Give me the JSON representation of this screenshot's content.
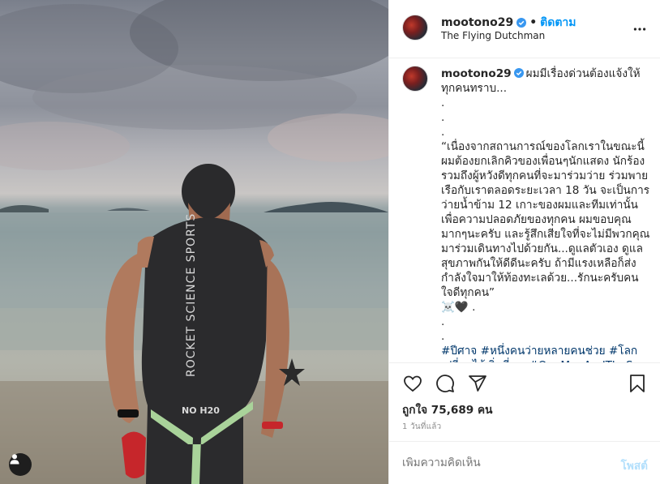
{
  "post": {
    "username": "mootono29",
    "follow_label": "ติดตาม",
    "separator": "•",
    "location": "The Flying Dutchman",
    "caption": {
      "username": "mootono29",
      "lines": [
        "ผมมีเรื่องด่วนต้องแจ้งให้ทุกคนทราบ...",
        ".",
        ".",
        ".",
        "“เนื่องจากสถานการณ์ของโลกเราในขณะนี้ ผมต้องยกเลิกคิวของเพื่อนๆนักแสดง นักร้อง รวมถึงผู้หวังดีทุกคนที่จะมาร่วมว่าย ร่วมพายเรือกับเราตลอดระยะเวลา 18 วัน จะเป็นการว่ายน้ำข้าม 12 เกาะของผมและทีมเท่านั้น เพื่อความปลอดภัยของทุกคน ผมขอบคุณมากๆนะครับ และรู้สึกเสียใจที่จะไม่มีพวกคุณมาร่วมเดินทางไปด้วยกัน...ดูแลตัวเอง ดูแลสุขภาพกันให้ดีดีนะครับ ถ้ามีแรงเหลือก็ส่งกำลังใจมาให้ท้องทะเลด้วย...รักนะครับคนใจดีทุกคน”",
        "☠️🖤 .",
        ".",
        "."
      ],
      "hashtags": "#ปีศาจ #หนึ่งคนว่ายหลายคนช่วย #โลกเปลี่ยนได้เริ่มที่เรา #OneManAndTheSea"
    },
    "likes_label": "ถูกใจ 75,689 คน",
    "time_label": "1 วันที่แล้ว",
    "comment_placeholder": "เพิ่มความคิดเห็น",
    "post_button": "โพสต์",
    "photo": {
      "wetsuit_brand": "ROCKET SCIENCE SPORTS",
      "wetsuit_model": "NO H20"
    }
  },
  "colors": {
    "link_blue": "#0095f6",
    "hashtag": "#00376b",
    "verified": "#3897f0",
    "post_disabled": "#b2dffc",
    "muted": "#8e8e8e"
  },
  "icons": [
    "verified-badge-icon",
    "more-options-icon",
    "heart-icon",
    "comment-icon",
    "share-icon",
    "bookmark-icon",
    "user-tag-icon"
  ]
}
